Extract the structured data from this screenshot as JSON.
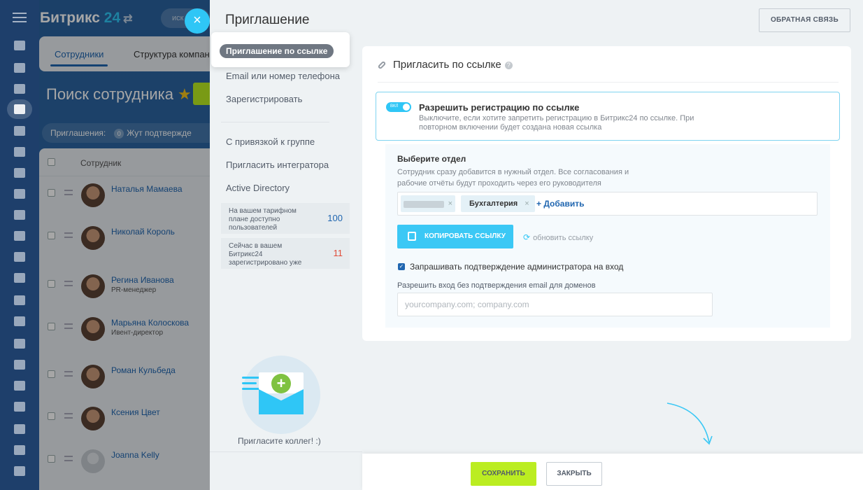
{
  "app": {
    "brand": "Битрикс",
    "brand_number": "24",
    "brand_switch": "⇄",
    "search_placeholder": "иск",
    "close_glyph": "×"
  },
  "bg": {
    "tabs": [
      "Сотрудники",
      "Структура компан"
    ],
    "title": "Поиск сотрудника",
    "star": "★",
    "filter_label": "Приглашения:",
    "filter_count": "0",
    "filter_text": "Жут подтвержде",
    "table_header": "Сотрудник",
    "employees": [
      {
        "name": "Наталья Мамаева",
        "position": ""
      },
      {
        "name": "Николай Король",
        "position": ""
      },
      {
        "name": "Регина Иванова",
        "position": "PR-менеджер"
      },
      {
        "name": "Марьяна Колоскова",
        "position": "Ивент-директор"
      },
      {
        "name": "Роман Кульбеда",
        "position": ""
      },
      {
        "name": "Ксения Цвет",
        "position": ""
      },
      {
        "name": "Joanna Kelly",
        "position": ""
      }
    ]
  },
  "invite": {
    "title": "Приглашение",
    "feedback": "ОБРАТНАЯ СВЯЗЬ",
    "menu": {
      "active": "Приглашение по ссылке",
      "items": [
        "Email или номер телефона",
        "Зарегистрировать",
        "С привязкой к группе",
        "Пригласить интегратора",
        "Active Directory"
      ]
    },
    "tarif": [
      {
        "text": "На вашем тарифном плане доступно пользователей",
        "value": "100",
        "color": "#2066b0"
      },
      {
        "text": "Сейчас в вашем Битрикс24 зарегистрировано уже",
        "value": "11",
        "color": "#e04c39"
      }
    ],
    "illus_caption": "Пригласите коллег! :)",
    "plus_glyph": "+"
  },
  "panel": {
    "header": "Пригласить по ссылке",
    "help": "?",
    "toggle_state": "ВКЛ",
    "toggle_title": "Разрешить регистрацию по ссылке",
    "toggle_desc": "Выключите, если хотите запретить регистрацию в Битрикс24 по ссылке. При повторном включении будет создана новая ссылка",
    "section_title": "Выберите отдел",
    "section_desc": "Сотрудник сразу добавится в нужный отдел. Все согласования и рабочие отчёты будут проходить через его руководителя",
    "tag_remove": "×",
    "tag_department": "Бухгалтерия",
    "add_label": "+ Добавить",
    "copy_button": "КОПИРОВАТЬ ССЫЛКУ",
    "refresh_icon": "⟳",
    "refresh_label": "обновить ссылку",
    "checkbox_mark": "✓",
    "confirm_label": "Запрашивать подтверждение администратора на вход",
    "domains_label": "Разрешить вход без подтверждения email для доменов",
    "domains_placeholder": "yourcompany.com; company.com"
  },
  "footer": {
    "save": "СОХРАНИТЬ",
    "close": "ЗАКРЫТЬ"
  },
  "colors": {
    "accent": "#2fc6f6",
    "save_green": "#bbed21",
    "link_blue": "#2066b0"
  }
}
